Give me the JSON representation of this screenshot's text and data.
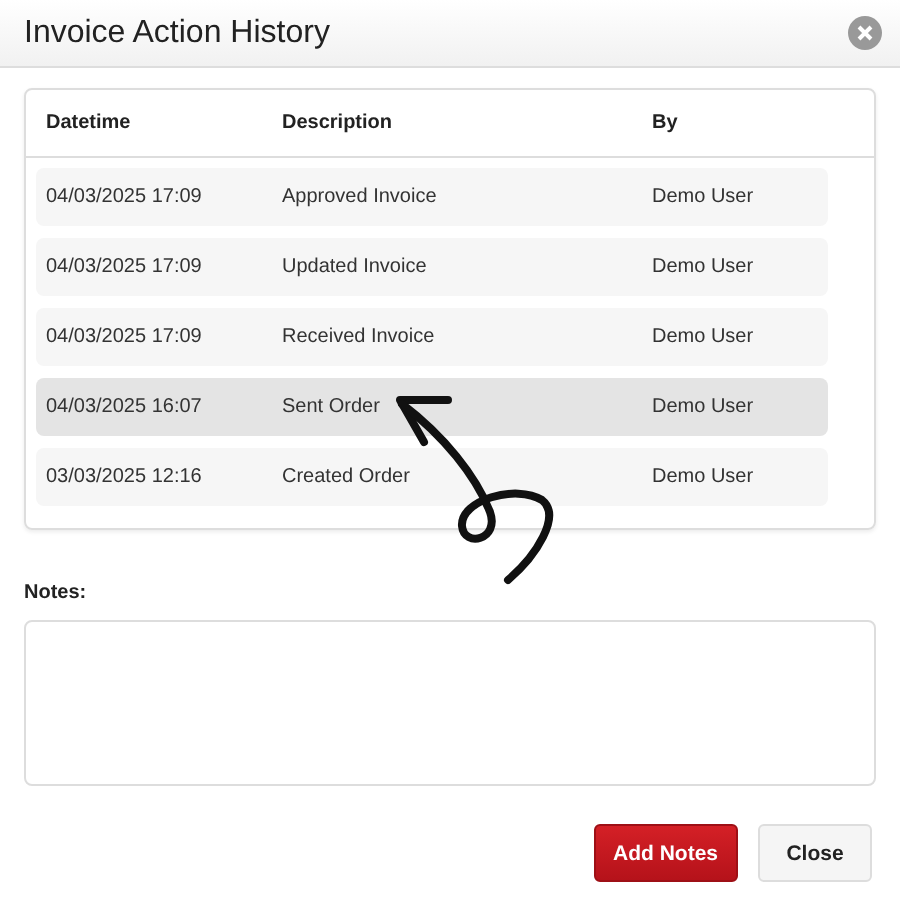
{
  "dialog": {
    "title": "Invoice Action History"
  },
  "table": {
    "columns": [
      "Datetime",
      "Description",
      "By"
    ],
    "rows": [
      {
        "cells": [
          "04/03/2025 17:09",
          "Approved Invoice",
          "Demo User"
        ],
        "selected": false
      },
      {
        "cells": [
          "04/03/2025 17:09",
          "Updated Invoice",
          "Demo User"
        ],
        "selected": false
      },
      {
        "cells": [
          "04/03/2025 17:09",
          "Received Invoice",
          "Demo User"
        ],
        "selected": false
      },
      {
        "cells": [
          "04/03/2025 16:07",
          "Sent Order",
          "Demo User"
        ],
        "selected": true
      },
      {
        "cells": [
          "03/03/2025 12:16",
          "Created Order",
          "Demo User"
        ],
        "selected": false
      }
    ]
  },
  "notes": {
    "label": "Notes:"
  },
  "buttons": [
    {
      "label": "Add Notes",
      "kind": "primary"
    },
    {
      "label": "Close",
      "kind": "secondary"
    }
  ]
}
